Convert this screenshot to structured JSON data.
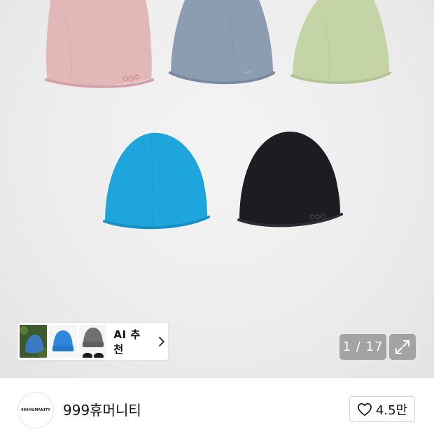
{
  "gallery": {
    "product_colors": [
      "pink",
      "grey-blue",
      "sage-green",
      "sky-blue",
      "black"
    ],
    "counter_current": "1",
    "counter_total": "17",
    "counter_text": "1 / 17",
    "expand_icon": "expand-icon"
  },
  "recommend": {
    "label": "AI 추천",
    "thumbnails": [
      "blue-beanie-on-grass",
      "blue-beanie",
      "grey-and-black-beanies"
    ],
    "chevron_icon": "chevron-right-icon"
  },
  "brand": {
    "logo_text": "999HUMANITY",
    "name": "999휴머니티"
  },
  "like": {
    "icon": "heart-icon",
    "count": "4.5만"
  },
  "colors": {
    "pink": "#e2b7b8",
    "grey_blue": "#8c9cb1",
    "sage": "#c4d4a7",
    "sky_blue": "#1ea5dc",
    "black": "#1c1d22"
  }
}
